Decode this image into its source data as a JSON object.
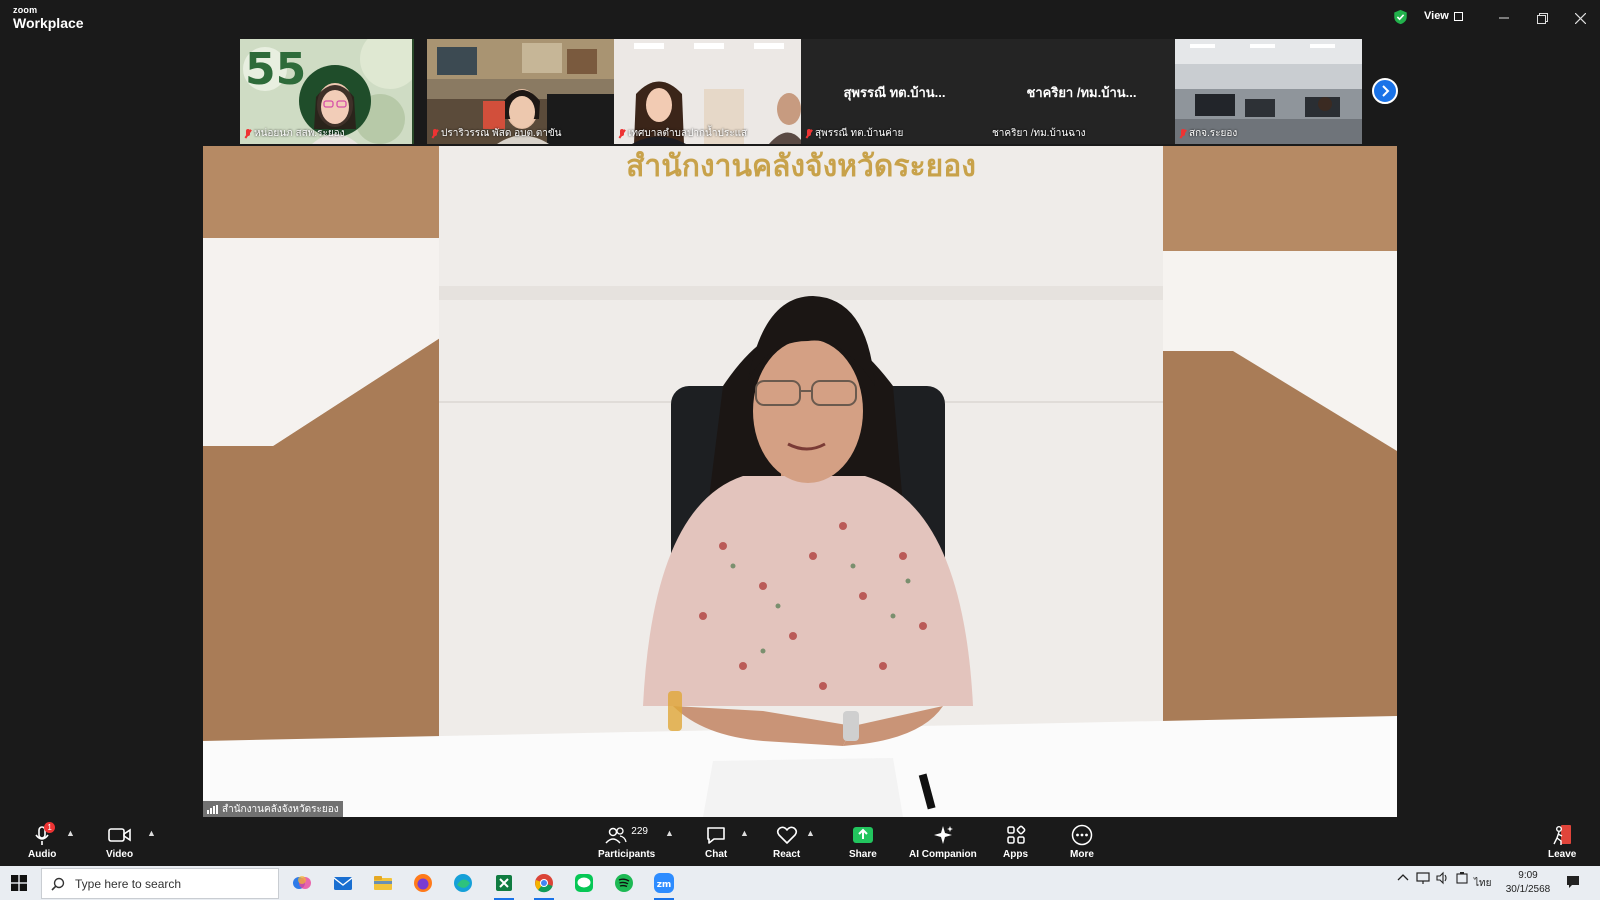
{
  "app": {
    "logo_top": "zoom",
    "logo_bottom": "Workplace",
    "view_label": "View"
  },
  "thumbnails": [
    {
      "name": "หน่อยนภ สสพ.ระยอง",
      "muted": true
    },
    {
      "name": "ปราริวรรณ พัสด อบต.ตาขัน",
      "muted": true
    },
    {
      "name": "เทศบาลตำบลปากน้ำประแส",
      "muted": true
    },
    {
      "name": "สุพรรณี ทต.บ้านค่าย",
      "big_name": "สุพรรณี ทต.บ้าน...",
      "muted": true
    },
    {
      "name": "ชาคริยา /ทม.บ้านฉาง",
      "big_name": "ชาคริยา /ทม.บ้าน...",
      "muted": false
    },
    {
      "name": "สกจ.ระยอง",
      "muted": true
    }
  ],
  "main_video": {
    "sign_text": "สำนักงานคลังจังหวัดระยอง",
    "speaker_name": "สำนักงานคลังจังหวัดระยอง"
  },
  "toolbar": {
    "audio": "Audio",
    "audio_badge": "1",
    "video": "Video",
    "participants": "Participants",
    "participants_count": "229",
    "chat": "Chat",
    "react": "React",
    "share": "Share",
    "ai_companion": "AI Companion",
    "apps": "Apps",
    "more": "More",
    "leave": "Leave"
  },
  "taskbar": {
    "search_placeholder": "Type here to search",
    "language": "ไทย",
    "time": "9:09",
    "date": "30/1/2568"
  },
  "colors": {
    "accent": "#1a73e8",
    "share_green": "#22c55e",
    "muted_red": "#e33333",
    "leave_red": "#e0443a"
  }
}
